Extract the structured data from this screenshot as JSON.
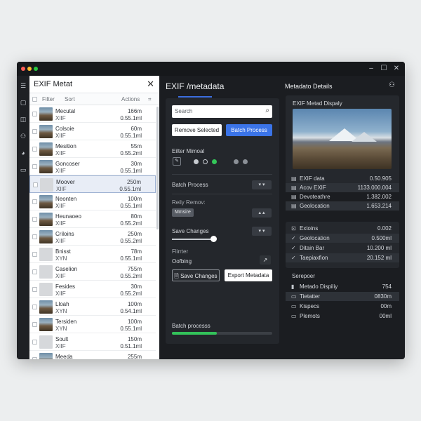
{
  "window": {
    "controls": [
      "–",
      "☐",
      "✕"
    ],
    "dots": [
      "#ff5f57",
      "#febc2e",
      "#28c840"
    ]
  },
  "rail": {
    "icons": [
      "menu-icon",
      "bag-icon",
      "layers-icon",
      "people-icon",
      "chart-icon",
      "card-icon"
    ]
  },
  "left_panel": {
    "title": "EXIF Metat",
    "close": "✕",
    "tools": {
      "filter": "Filter",
      "sort": "Sort",
      "actions": "Actions",
      "grid": "⌗"
    },
    "rows": [
      {
        "name": "Mecutal",
        "sub": "XIIF",
        "v1": "166m",
        "v2": "0.55.1ml",
        "thumb": "photo",
        "selected": false
      },
      {
        "name": "Colsoie",
        "sub": "XIIF",
        "v1": "60m",
        "v2": "0.55.1ml",
        "thumb": "photo",
        "selected": false
      },
      {
        "name": "Mesition",
        "sub": "XIIF",
        "v1": "55m",
        "v2": "0.55.2ml",
        "thumb": "photo",
        "selected": false
      },
      {
        "name": "Goncoser",
        "sub": "XIIF",
        "v1": "30m",
        "v2": "0.55.1ml",
        "thumb": "photo",
        "selected": false
      },
      {
        "name": "Moover",
        "sub": "XIIF",
        "v1": "250m",
        "v2": "0.55.1ml",
        "thumb": "blank",
        "selected": true
      },
      {
        "name": "Neonten",
        "sub": "XIIF",
        "v1": "100m",
        "v2": "0.55.1ml",
        "thumb": "photo",
        "selected": false
      },
      {
        "name": "Heunaoeo",
        "sub": "XIIF",
        "v1": "80m",
        "v2": "0.55.2ml",
        "thumb": "photo",
        "selected": false
      },
      {
        "name": "Criloins",
        "sub": "XIIF",
        "v1": "250m",
        "v2": "0.55.2ml",
        "thumb": "photo",
        "selected": false
      },
      {
        "name": "Bnisst",
        "sub": "XYN",
        "v1": "78m",
        "v2": "0.55.1ml",
        "thumb": "blank",
        "selected": false
      },
      {
        "name": "Caselion",
        "sub": "XIIF",
        "v1": "755m",
        "v2": "0.55.2ml",
        "thumb": "blank",
        "selected": false
      },
      {
        "name": "Fesides",
        "sub": "XIIF",
        "v1": "30m",
        "v2": "0.55.2ml",
        "thumb": "blank",
        "selected": false
      },
      {
        "name": "Lloah",
        "sub": "XYN",
        "v1": "100m",
        "v2": "0.54.1ml",
        "thumb": "photo",
        "selected": false
      },
      {
        "name": "Tersiden",
        "sub": "XYN",
        "v1": "100m",
        "v2": "0.55.1ml",
        "thumb": "photo",
        "selected": false
      },
      {
        "name": "Soult",
        "sub": "XIIF",
        "v1": "150m",
        "v2": "0.51.1ml",
        "thumb": "blank",
        "selected": false
      },
      {
        "name": "Meeda",
        "sub": "",
        "v1": "255m",
        "v2": "",
        "thumb": "photo",
        "selected": false
      }
    ]
  },
  "middle": {
    "title": "EXIF /metadata",
    "search_placeholder": "Search",
    "remove_selected": "Remove Selected",
    "batch_process_btn": "Batch Process",
    "filter_label": "Eilter Mimoal",
    "batch_process_label": "Batch Process",
    "remove_label": "Reily Remov:",
    "chip": "Mmsire",
    "save_changes_label": "Save Changes",
    "filter2": "Flirrter",
    "ordering": "Oofbing",
    "save_btn": "Save Changes",
    "export_btn": "Export Metadata",
    "batch_progress_label": "Batch processs",
    "batch_progress": 0.45,
    "slider_value": 0.9
  },
  "right": {
    "title": "Metadato Details",
    "preview_title": "EXIF Metad Dispaly",
    "group1": [
      {
        "icon": "▤",
        "key": "EXIF data",
        "value": "0.50.905"
      },
      {
        "icon": "▤",
        "key": "Acov EXIF",
        "value": "1133.000.004"
      },
      {
        "icon": "▤",
        "key": "Devoteathre",
        "value": "1.382.002"
      },
      {
        "icon": "▤",
        "key": "Geolocation",
        "value": "1.653.214"
      }
    ],
    "group2": [
      {
        "icon": "⊡",
        "key": "Extoins",
        "value": "0.002"
      },
      {
        "icon": "✓",
        "key": "Geolocation",
        "value": "0.500ml"
      },
      {
        "icon": "✓",
        "key": "Ditain Bar",
        "value": "10.200 ml"
      },
      {
        "icon": "✓",
        "key": "Taepiaxfion",
        "value": "20.152 ml"
      }
    ],
    "section": "Serepoer",
    "group3": [
      {
        "icon": "▮",
        "key": "Metado Dispiliy",
        "value": "754"
      },
      {
        "icon": "▭",
        "key": "Tietatter",
        "value": "0830m"
      },
      {
        "icon": "▭",
        "key": "Kispecs",
        "value": "00m"
      },
      {
        "icon": "▭",
        "key": "Plemots",
        "value": "00ml"
      }
    ]
  }
}
